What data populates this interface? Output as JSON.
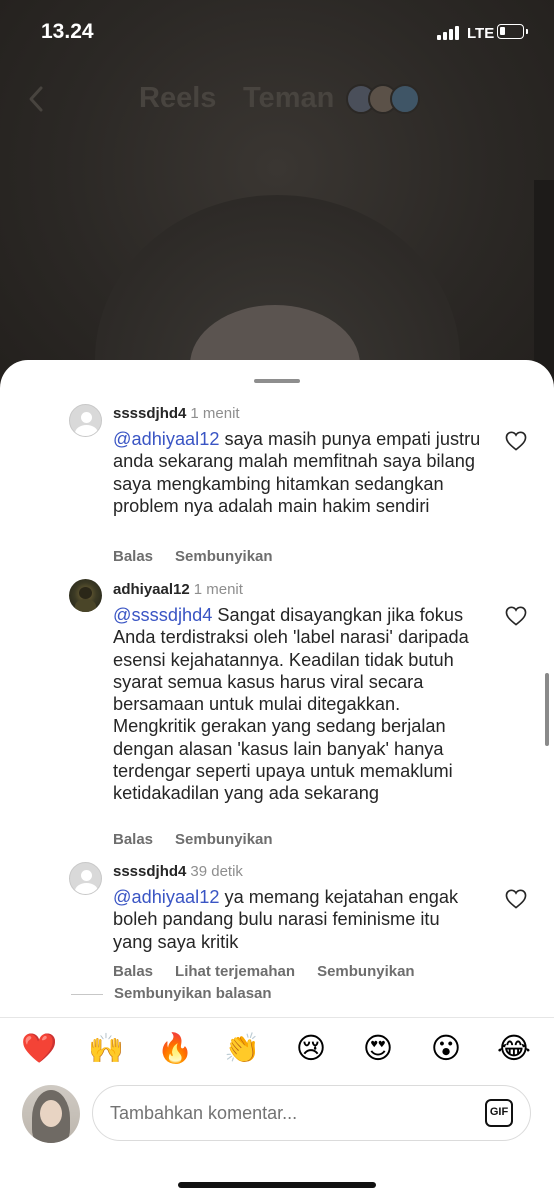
{
  "status_bar": {
    "time": "13.24",
    "network": "LTE",
    "signal_icon": "signal-bars-icon",
    "battery_level": 0.15
  },
  "top_nav": {
    "tabs": [
      {
        "label": "Reels"
      },
      {
        "label": "Teman"
      }
    ],
    "back_icon": "chevron-left-icon"
  },
  "comments": [
    {
      "username": "ssssdjhd4",
      "time": "1 menit",
      "mention": "@adhiyaal12",
      "text": " saya masih punya empati justru anda sekarang malah memfitnah saya bilang saya mengkambing hitamkan sedangkan problem nya adalah main hakim sendiri",
      "actions": [
        "Balas",
        "Sembunyikan"
      ]
    },
    {
      "username": "adhiyaal12",
      "time": "1 menit",
      "mention": "@ssssdjhd4",
      "text": " Sangat disayangkan jika fokus Anda terdistraksi oleh 'label narasi' daripada esensi kejahatannya. Keadilan tidak butuh syarat semua kasus harus viral secara bersamaan untuk mulai ditegakkan. Mengkritik gerakan yang sedang berjalan dengan alasan 'kasus lain banyak' hanya terdengar seperti upaya untuk memaklumi ketidakadilan yang ada sekarang",
      "actions": [
        "Balas",
        "Sembunyikan"
      ]
    },
    {
      "username": "ssssdjhd4",
      "time": "39 detik",
      "mention": "@adhiyaal12",
      "text": " ya memang kejatahan engak boleh pandang bulu narasi feminisme itu yang saya kritik",
      "actions": [
        "Balas",
        "Lihat terjemahan",
        "Sembunyikan"
      ]
    }
  ],
  "hide_replies_label": "Sembunyikan balasan",
  "emoji_bar": [
    "❤️",
    "🙌",
    "🔥",
    "👏",
    "😢",
    "😍",
    "😮",
    "😂"
  ],
  "composer": {
    "placeholder": "Tambahkan komentar...",
    "gif_label": "GIF"
  },
  "colors": {
    "mention": "#3a55c4",
    "secondary_text": "#8e8e8e",
    "sheet_bg": "#ffffff"
  }
}
